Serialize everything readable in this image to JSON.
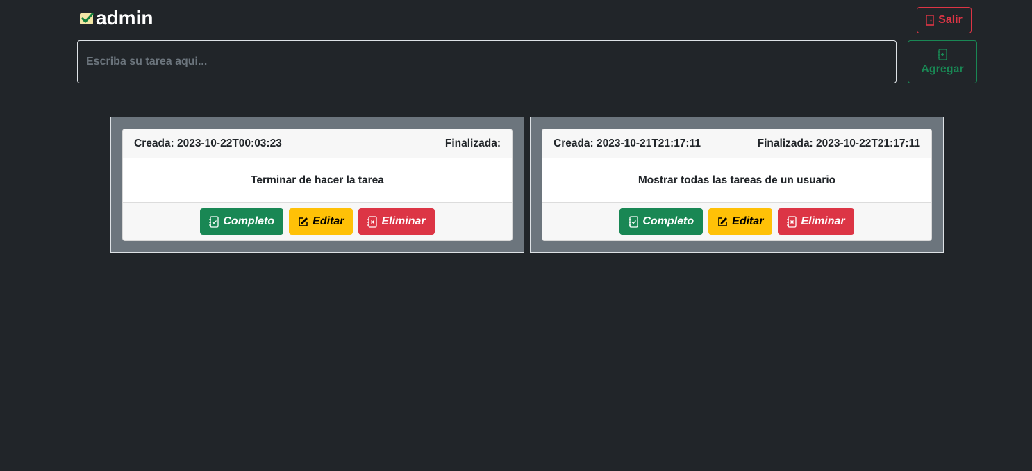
{
  "header": {
    "username": "admin",
    "logout_label": "Salir"
  },
  "new_task": {
    "placeholder": "Escriba su tarea aqui...",
    "value": "",
    "add_label": "Agregar"
  },
  "labels": {
    "created": "Creada:",
    "finished": "Finalizada:"
  },
  "tasks": [
    {
      "created": "2023-10-22T00:03:23",
      "finished": "",
      "description": "Terminar de hacer la tarea",
      "complete_label": "Completo",
      "edit_label": "Editar",
      "delete_label": "Eliminar"
    },
    {
      "created": "2023-10-21T21:17:11",
      "finished": "2023-10-22T21:17:11",
      "description": "Mostrar todas las tareas de un usuario",
      "complete_label": "Completo",
      "edit_label": "Editar",
      "delete_label": "Eliminar"
    }
  ],
  "colors": {
    "background": "#212529",
    "success": "#198754",
    "warning": "#ffc107",
    "danger": "#dc3545",
    "card_container": "#6c757d"
  },
  "icons": {
    "brand": "check-square-icon",
    "logout": "door-icon",
    "add": "journal-plus-icon",
    "complete": "journal-check-icon",
    "edit": "pencil-square-icon",
    "delete": "journal-x-icon"
  }
}
